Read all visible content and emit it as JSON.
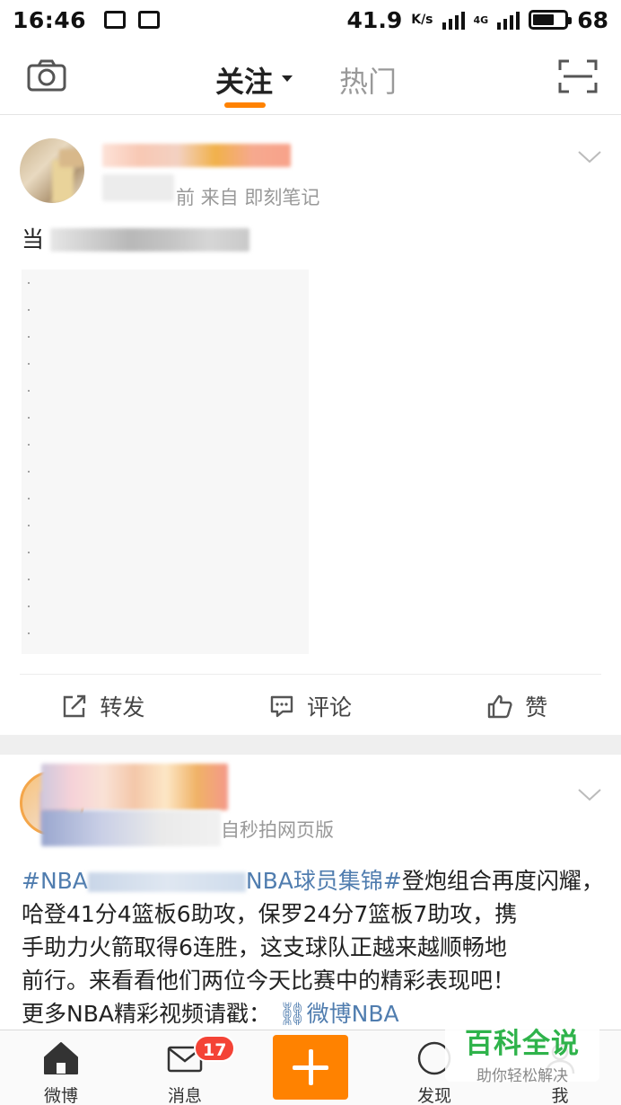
{
  "status_bar": {
    "time": "16:46",
    "net_speed": "41.9",
    "net_speed_unit": "K/s",
    "network_type": "4G",
    "battery": "68"
  },
  "top_nav": {
    "tab_following": "关注",
    "tab_hot": "热门"
  },
  "posts": [
    {
      "meta_suffix": "前  来自 即刻笔记",
      "text_prefix": "当",
      "actions": {
        "repost": "转发",
        "comment": "评论",
        "like": "赞"
      }
    },
    {
      "meta_suffix": "自秒拍网页版",
      "tag_1": "#NBA",
      "tag_2": "NBA球员集锦#",
      "text_line_1_rest": "登炮组合再度闪耀，",
      "text_line_2": "哈登41分4篮板6助攻，保罗24分7篮板7助攻，携",
      "text_line_3": "手助力火箭取得6连胜，这支球队正越来越顺畅地",
      "text_line_4": "前行。来看看他们两位今天比赛中的精彩表现吧！",
      "text_line_5": "更多NBA精彩视频请戳：",
      "link_text": "微博NBA"
    }
  ],
  "tab_bar": {
    "home": "微博",
    "messages": "消息",
    "messages_badge": "17",
    "discover": "发现",
    "me": "我"
  },
  "watermark": {
    "title": "百科全说",
    "subtitle": "助你轻松解决"
  },
  "colors": {
    "accent": "#ff8200",
    "link": "#507daf",
    "badge": "#f44336",
    "watermark": "#2fb34b"
  }
}
